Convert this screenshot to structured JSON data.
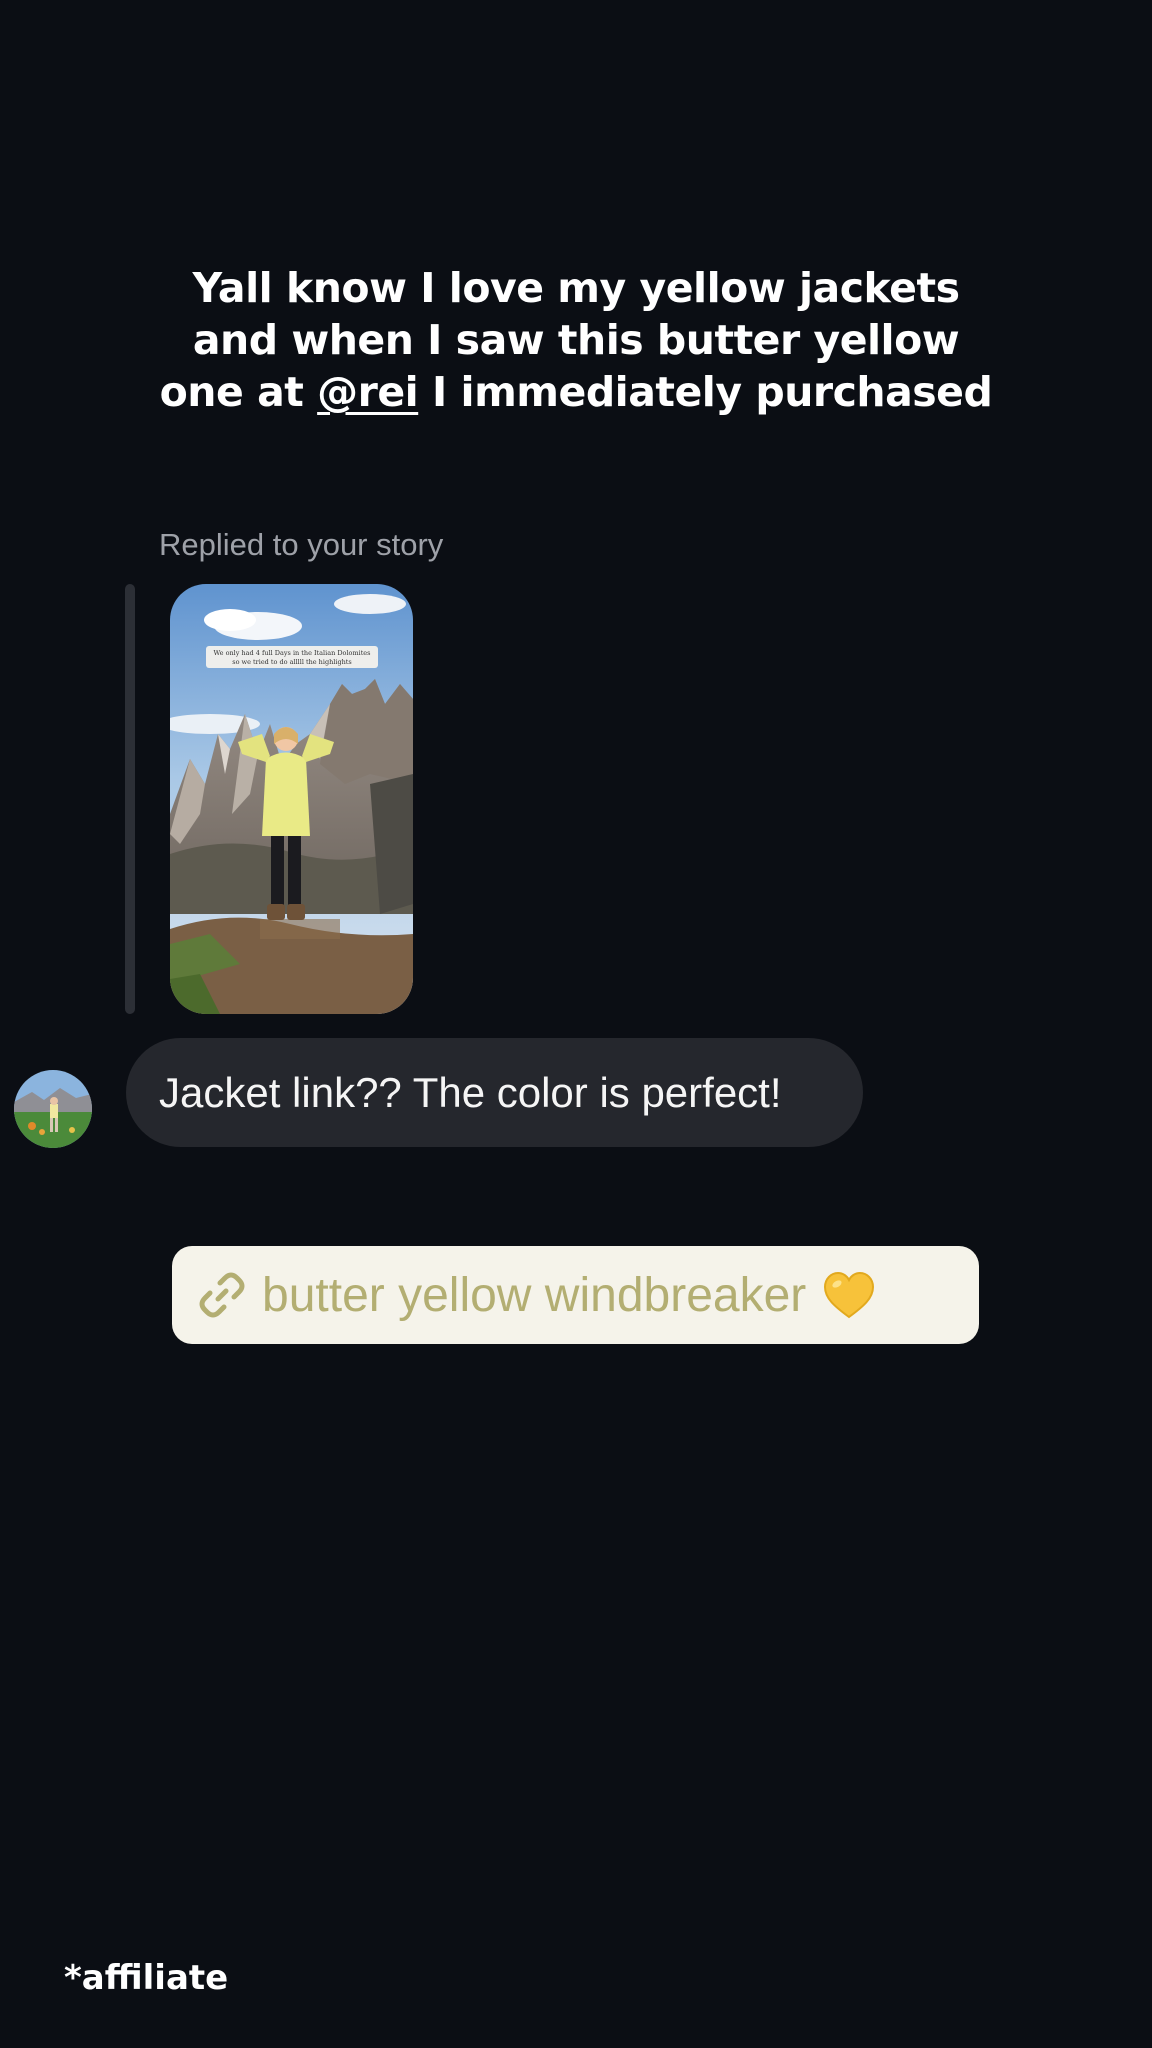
{
  "caption": {
    "line1": "Yall know I love my yellow jackets",
    "line2": "and when I saw this butter yellow",
    "line3_before": "one at ",
    "mention": "@rei",
    "line3_after": " I immediately purchased"
  },
  "reply": {
    "label": "Replied to your story",
    "story_caption_line1": "We only had 4 full Days in the Italian Dolomites",
    "story_caption_line2": "so we tried to do alllll the highlights"
  },
  "message": {
    "text": "Jacket link?? The color is perfect!"
  },
  "link_sticker": {
    "text": "butter yellow windbreaker",
    "icon": "link-icon",
    "emoji_icon": "yellow-heart-icon"
  },
  "footer": {
    "affiliate": "*affiliate"
  },
  "colors": {
    "background": "#0b0e14",
    "bubble": "#25272d",
    "sticker_bg": "#f5f3ea",
    "sticker_text": "#b3ae72",
    "jacket": "#e9ea86"
  }
}
